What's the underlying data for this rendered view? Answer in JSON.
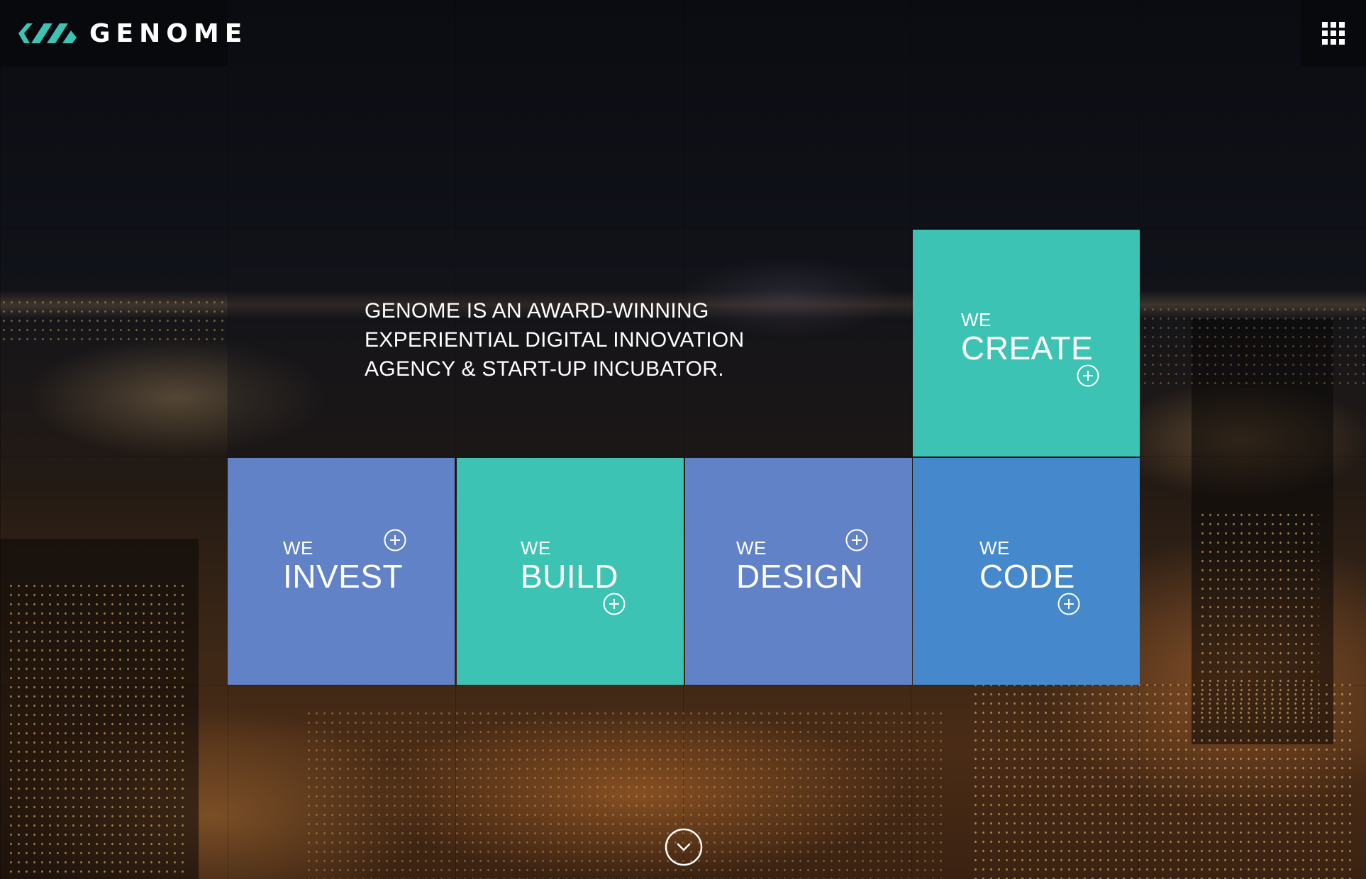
{
  "brand": {
    "name": "GENOME",
    "accent_teal": "#3cc3b4",
    "accent_periwinkle": "#6282c8",
    "accent_blue": "#4589cc"
  },
  "header": {
    "logo_icon": "genome-stripes-logo",
    "menu_icon": "grid-menu-icon"
  },
  "hero": {
    "intro_lines": [
      "GENOME IS AN AWARD-WINNING",
      "EXPERIENTIAL DIGITAL INNOVATION",
      "AGENCY & START-UP INCUBATOR."
    ]
  },
  "tiles": [
    {
      "prefix": "WE",
      "word": "CREATE",
      "icon": "plus-circle-icon"
    },
    {
      "prefix": "WE",
      "word": "INVEST",
      "icon": "plus-circle-icon"
    },
    {
      "prefix": "WE",
      "word": "BUILD",
      "icon": "plus-circle-icon"
    },
    {
      "prefix": "WE",
      "word": "DESIGN",
      "icon": "plus-circle-icon"
    },
    {
      "prefix": "WE",
      "word": "CODE",
      "icon": "plus-circle-icon"
    }
  ],
  "footer": {
    "scroll_icon": "chevron-down-circle-icon"
  }
}
